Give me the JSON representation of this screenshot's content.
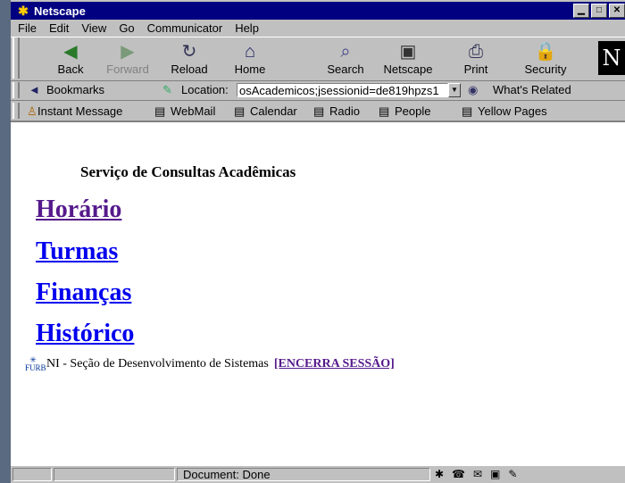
{
  "window": {
    "title": "Netscape",
    "buttons": [
      "▁",
      "□",
      "✕"
    ]
  },
  "menu": [
    "File",
    "Edit",
    "View",
    "Go",
    "Communicator",
    "Help"
  ],
  "toolbar": [
    {
      "label": "Back",
      "icon": "◀",
      "disabled": false
    },
    {
      "label": "Forward",
      "icon": "▶",
      "disabled": true
    },
    {
      "label": "Reload",
      "icon": "↻",
      "disabled": false
    },
    {
      "label": "Home",
      "icon": "⌂",
      "disabled": false
    },
    {
      "label": "Search",
      "icon": "⌕",
      "disabled": false
    },
    {
      "label": "Netscape",
      "icon": "▣",
      "disabled": false
    },
    {
      "label": "Print",
      "icon": "⎙",
      "disabled": false
    },
    {
      "label": "Security",
      "icon": "🔒",
      "disabled": false
    }
  ],
  "location": {
    "bookmarks_label": "Bookmarks",
    "location_label": "Location:",
    "url": "osAcademicos;jsessionid=de819hpzs1",
    "related": "What's Related"
  },
  "personal_toolbar": [
    "Instant Message",
    "WebMail",
    "Calendar",
    "Radio",
    "People",
    "Yellow Pages"
  ],
  "page": {
    "heading": "Serviço de Consultas Acadêmicas",
    "links": [
      "Horário",
      "Turmas",
      "Finanças",
      "Histórico"
    ],
    "footer_text": "NI - Seção de Desenvolvimento de Sistemas",
    "footer_logo": "FURB",
    "session_link": "[ENCERRA SESSÃO]"
  },
  "status": {
    "text": "Document: Done"
  },
  "colors": {
    "titlebar": "#000080",
    "link": "#0000ee",
    "visited": "#551a8b"
  }
}
